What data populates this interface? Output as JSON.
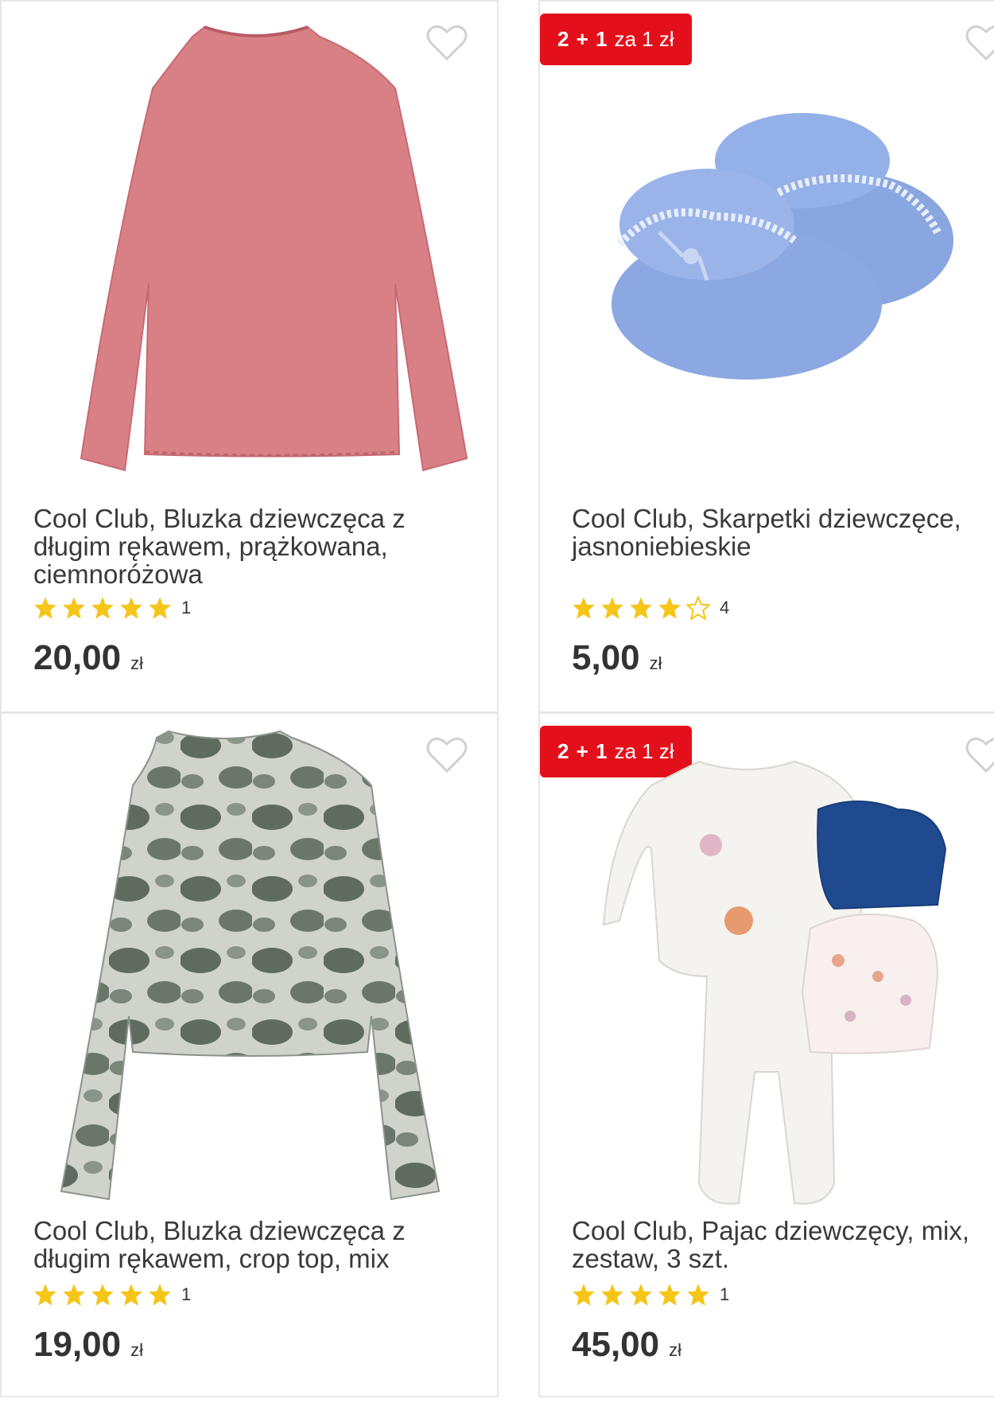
{
  "products": [
    {
      "title": "Cool Club, Bluzka dziewczęca z długim rękawem, prążkowana, ciemnoróżowa",
      "rating": 5,
      "rating_count": "1",
      "price": "20,00",
      "currency": "zł",
      "badge": null,
      "image": "pink-long-sleeve-top"
    },
    {
      "title": "Cool Club, Skarpetki dziewczęce, jasnoniebieskie",
      "rating": 4,
      "rating_count": "4",
      "price": "5,00",
      "currency": "zł",
      "badge": {
        "strong": "2 + 1",
        "text": "za 1 zł"
      },
      "image": "blue-baby-socks"
    },
    {
      "title": "Cool Club, Bluzka dziewczęca z długim rękawem, crop top, mix",
      "rating": 5,
      "rating_count": "1",
      "price": "19,00",
      "currency": "zł",
      "badge": null,
      "image": "tie-dye-crop-top"
    },
    {
      "title": "Cool Club, Pajac dziewczęcy, mix, zestaw, 3 szt.",
      "rating": 5,
      "rating_count": "1",
      "price": "45,00",
      "currency": "zł",
      "badge": {
        "strong": "2 + 1",
        "text": "za 1 zł"
      },
      "image": "baby-romper-set"
    }
  ],
  "colors": {
    "badge": "#e3101b",
    "star": "#f5c518",
    "heart_outline": "#d0d0d0"
  }
}
